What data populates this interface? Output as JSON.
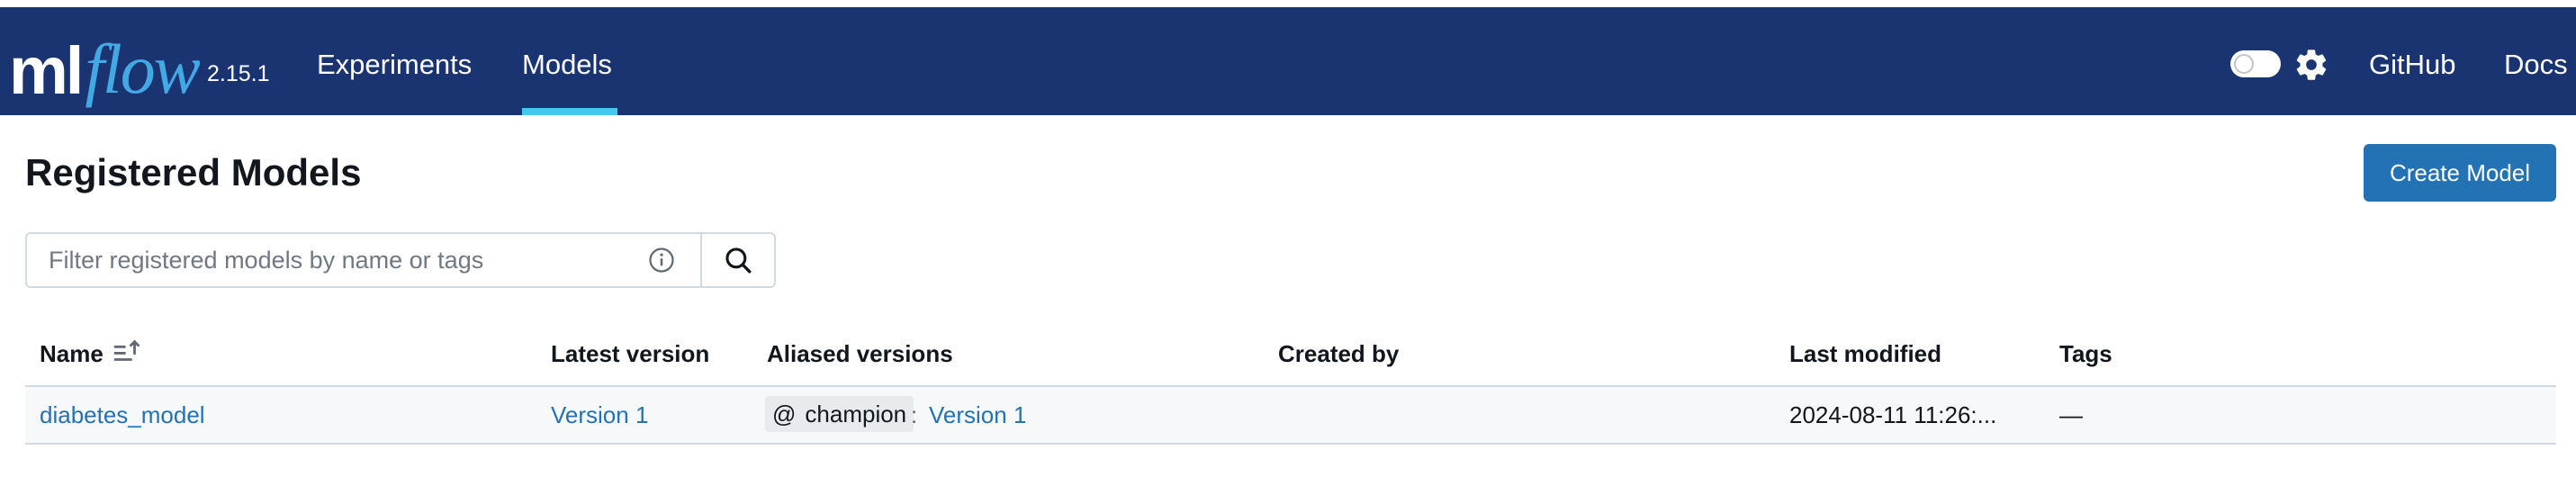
{
  "header": {
    "logo_ml": "ml",
    "logo_flow": "flow",
    "version": "2.15.1",
    "nav": [
      {
        "label": "Experiments"
      },
      {
        "label": "Models",
        "active": true
      }
    ],
    "right_links": [
      {
        "label": "GitHub"
      },
      {
        "label": "Docs"
      }
    ],
    "theme_toggle": {
      "state": "off",
      "icon": "gear-icon"
    }
  },
  "main": {
    "title": "Registered Models",
    "create_button": "Create Model",
    "search": {
      "placeholder": "Filter registered models by name or tags",
      "value": "",
      "info_icon": "info-icon",
      "button_icon": "search-icon"
    },
    "table": {
      "columns": [
        "Name",
        "Latest version",
        "Aliased versions",
        "Created by",
        "Last modified",
        "Tags"
      ],
      "sort_icon": "sort-ascending-icon",
      "rows": [
        {
          "name": "diabetes_model",
          "latest_version": "Version 1",
          "alias_at": "@",
          "alias_name": "champion",
          "alias_sep": ":",
          "alias_version": "Version 1",
          "created_by": "",
          "last_modified": "2024-08-11 11:26:...",
          "tags": "—"
        }
      ]
    }
  },
  "colors": {
    "header_bg": "#1a3472",
    "accent": "#43c9ed",
    "logo_flow": "#43a9e4",
    "primary_button": "#2272b4",
    "link": "#2272b4"
  }
}
